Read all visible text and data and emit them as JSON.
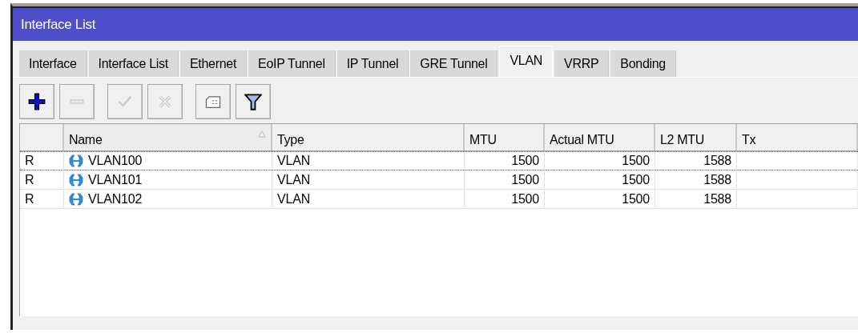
{
  "window": {
    "title": "Interface List"
  },
  "tabs": [
    {
      "label": "Interface",
      "selected": false
    },
    {
      "label": "Interface List",
      "selected": false
    },
    {
      "label": "Ethernet",
      "selected": false
    },
    {
      "label": "EoIP Tunnel",
      "selected": false
    },
    {
      "label": "IP Tunnel",
      "selected": false
    },
    {
      "label": "GRE Tunnel",
      "selected": false
    },
    {
      "label": "VLAN",
      "selected": true
    },
    {
      "label": "VRRP",
      "selected": false
    },
    {
      "label": "Bonding",
      "selected": false
    }
  ],
  "toolbar": [
    {
      "kind": "add",
      "disabled": false
    },
    {
      "kind": "remove",
      "disabled": true
    },
    {
      "kind": "enable",
      "disabled": true
    },
    {
      "kind": "disable",
      "disabled": true
    },
    {
      "kind": "comment",
      "disabled": false
    },
    {
      "kind": "filter",
      "disabled": false
    }
  ],
  "table": {
    "columns": [
      {
        "sorted": false
      },
      {
        "label": "Name",
        "sorted": true
      },
      {
        "label": "Type",
        "sorted": false
      },
      {
        "label": "MTU",
        "sorted": false
      },
      {
        "label": "Actual MTU",
        "sorted": false
      },
      {
        "label": "L2 MTU",
        "sorted": false
      },
      {
        "label": "Tx",
        "sorted": false
      }
    ],
    "rows": [
      {
        "flag": "R",
        "name": "VLAN100",
        "type": "VLAN",
        "mtu": "1500",
        "actual_mtu": "1500",
        "l2_mtu": "1588",
        "focused": true
      },
      {
        "flag": "R",
        "name": "VLAN101",
        "type": "VLAN",
        "mtu": "1500",
        "actual_mtu": "1500",
        "l2_mtu": "1588",
        "focused": false
      },
      {
        "flag": "R",
        "name": "VLAN102",
        "type": "VLAN",
        "mtu": "1500",
        "actual_mtu": "1500",
        "l2_mtu": "1588",
        "focused": false
      }
    ]
  }
}
